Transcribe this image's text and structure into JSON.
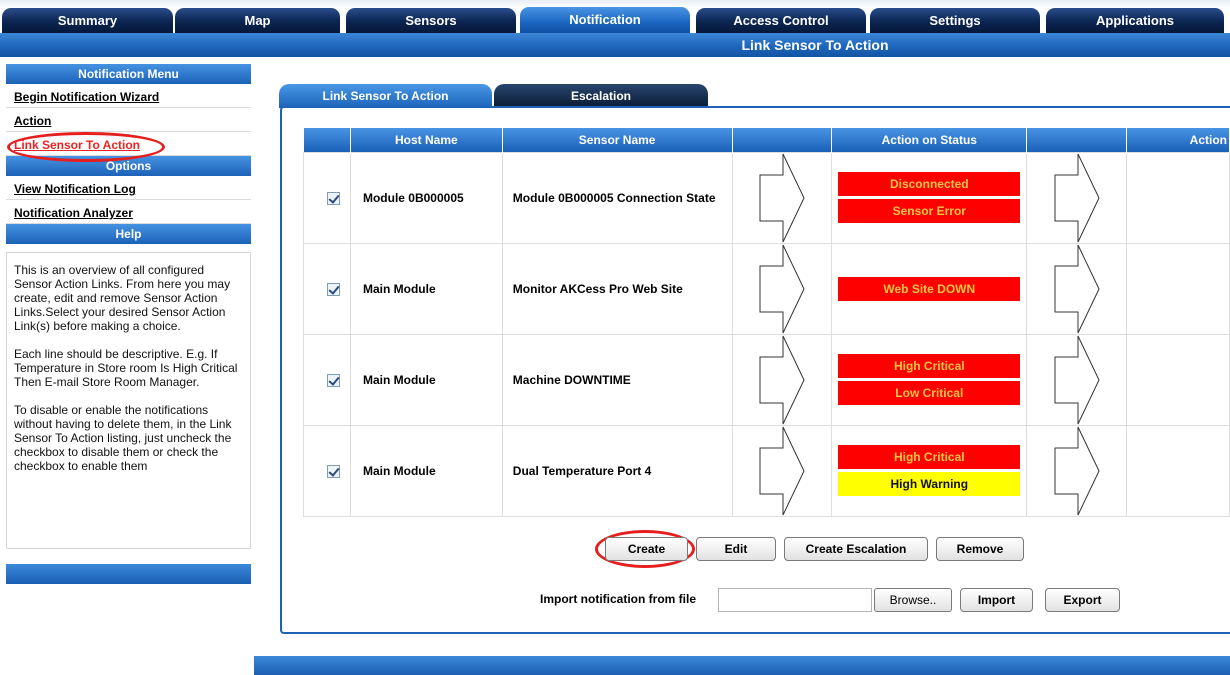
{
  "top_tabs": [
    {
      "label": "Summary"
    },
    {
      "label": "Map"
    },
    {
      "label": "Sensors"
    },
    {
      "label": "Notification"
    },
    {
      "label": "Access Control"
    },
    {
      "label": "Settings"
    },
    {
      "label": "Applications"
    }
  ],
  "page_title": "Link Sensor To Action",
  "sidebar": {
    "notification_menu_title": "Notification Menu",
    "notification_items": [
      "Begin Notification Wizard",
      "Action",
      "Link Sensor To Action"
    ],
    "options_title": "Options",
    "options_items": [
      "View Notification Log",
      "Notification Analyzer"
    ],
    "help_title": "Help",
    "help_text": "This is an overview of all configured Sensor Action Links. From here you may create, edit and remove Sensor Action Links.Select your desired Sensor Action Link(s) before making a choice.\n\nEach line should be descriptive. E.g. If Temperature in Store room Is High Critical Then E-mail Store Room Manager.\n\nTo disable or enable the notifications without having to delete them, in the Link Sensor To Action listing, just uncheck the checkbox to disable them or check the checkbox to enable them"
  },
  "subtabs": {
    "link": "Link Sensor To Action",
    "escalation": "Escalation"
  },
  "table": {
    "headers": {
      "host": "Host Name",
      "sensor": "Sensor Name",
      "status": "Action on Status",
      "action": "Action"
    },
    "rows": [
      {
        "checked": true,
        "host": "Module 0B000005",
        "sensor": "Module 0B000005 Connection State",
        "statuses": [
          {
            "label": "Disconnected",
            "color": "#ff0000"
          },
          {
            "label": "Sensor Error",
            "color": "#ff0000"
          }
        ]
      },
      {
        "checked": true,
        "host": "Main Module",
        "sensor": "Monitor AKCess Pro Web Site",
        "statuses": [
          {
            "label": "Web Site DOWN",
            "color": "#ff0000"
          }
        ]
      },
      {
        "checked": true,
        "host": "Main Module",
        "sensor": "Machine DOWNTIME",
        "statuses": [
          {
            "label": "High Critical",
            "color": "#ff0000"
          },
          {
            "label": "Low Critical",
            "color": "#ff0000"
          }
        ]
      },
      {
        "checked": true,
        "host": "Main Module",
        "sensor": "Dual Temperature Port 4",
        "statuses": [
          {
            "label": "High Critical",
            "color": "#ff0000"
          },
          {
            "label": "High Warning",
            "color": "#ffff00"
          }
        ]
      }
    ]
  },
  "buttons": {
    "create": "Create",
    "edit": "Edit",
    "create_escalation": "Create Escalation",
    "remove": "Remove",
    "browse": "Browse..",
    "import": "Import",
    "export": "Export"
  },
  "import": {
    "label": "Import notification from file",
    "file_value": ""
  },
  "colors": {
    "accent_blue": "#1d66bd",
    "dark_tab": "#0b2451",
    "status_red": "#ff0000",
    "status_yellow": "#ffff00",
    "highlight_ring": "#e61e1e"
  }
}
